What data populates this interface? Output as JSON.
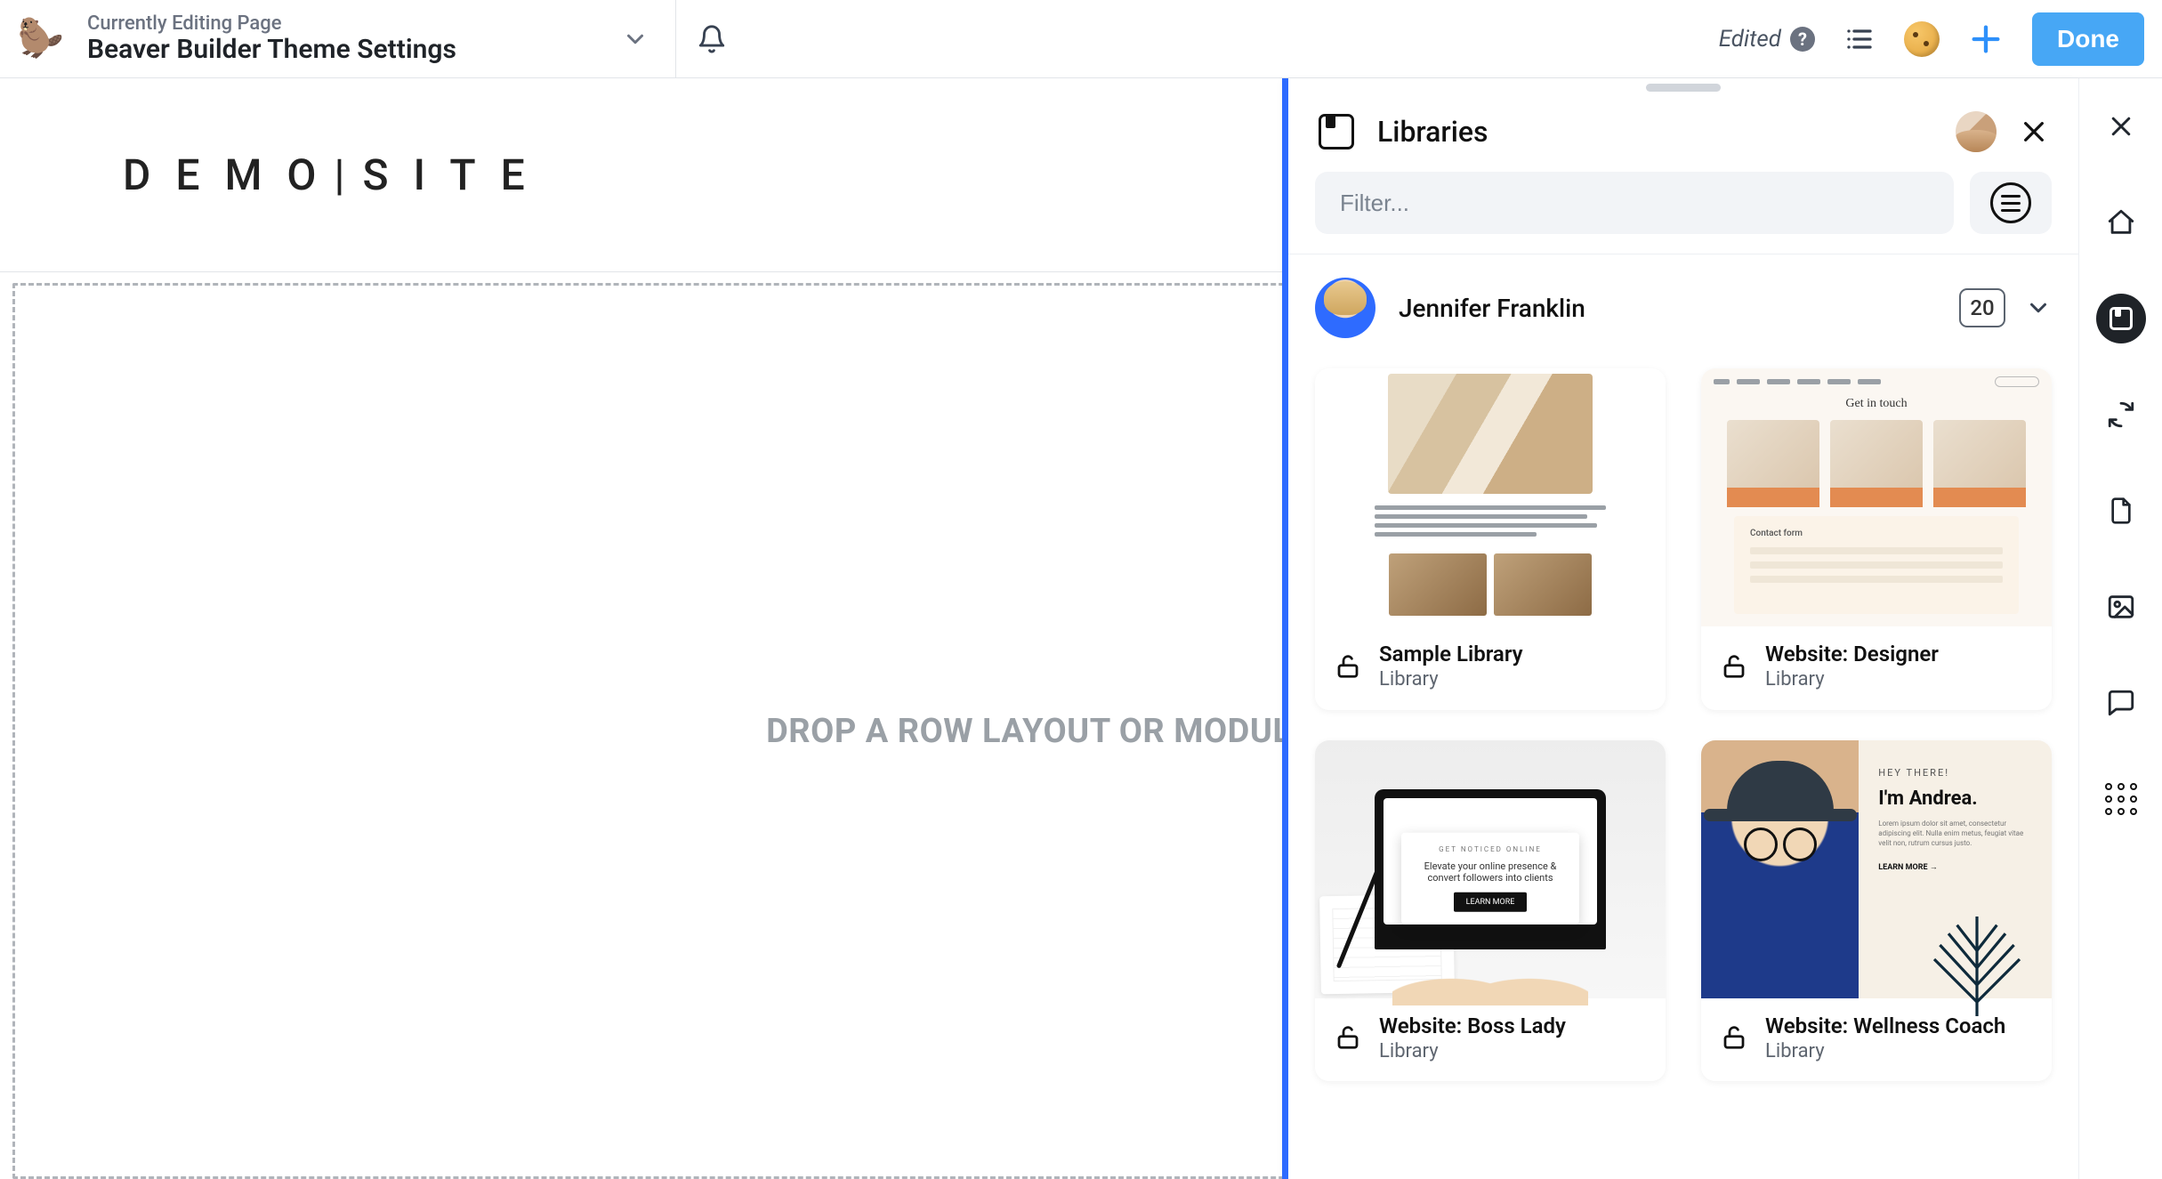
{
  "topbar": {
    "editing_label": "Currently Editing Page",
    "page_title": "Beaver Builder Theme Settings",
    "edited_label": "Edited",
    "done_label": "Done"
  },
  "site": {
    "title_left": "DEMO",
    "title_right": "SITE"
  },
  "canvas": {
    "dropzone_text": "DROP A ROW LAYOUT OR MODULE TO G"
  },
  "panel": {
    "title": "Libraries",
    "filter_placeholder": "Filter...",
    "owner_name": "Jennifer Franklin",
    "item_count": "20",
    "cards": [
      {
        "title": "Sample Library",
        "subtitle": "Library"
      },
      {
        "title": "Website: Designer",
        "subtitle": "Library",
        "thumb": {
          "heading": "Get in touch",
          "form_label": "Contact form"
        }
      },
      {
        "title": "Website: Boss Lady",
        "subtitle": "Library",
        "thumb": {
          "eyebrow": "GET NOTICED ONLINE",
          "line": "Elevate your online presence & convert followers into clients",
          "cta": "LEARN MORE"
        }
      },
      {
        "title": "Website: Wellness Coach",
        "subtitle": "Library",
        "thumb": {
          "eyebrow": "HEY THERE!",
          "heading": "I'm Andrea.",
          "cta": "LEARN MORE →"
        }
      }
    ]
  }
}
